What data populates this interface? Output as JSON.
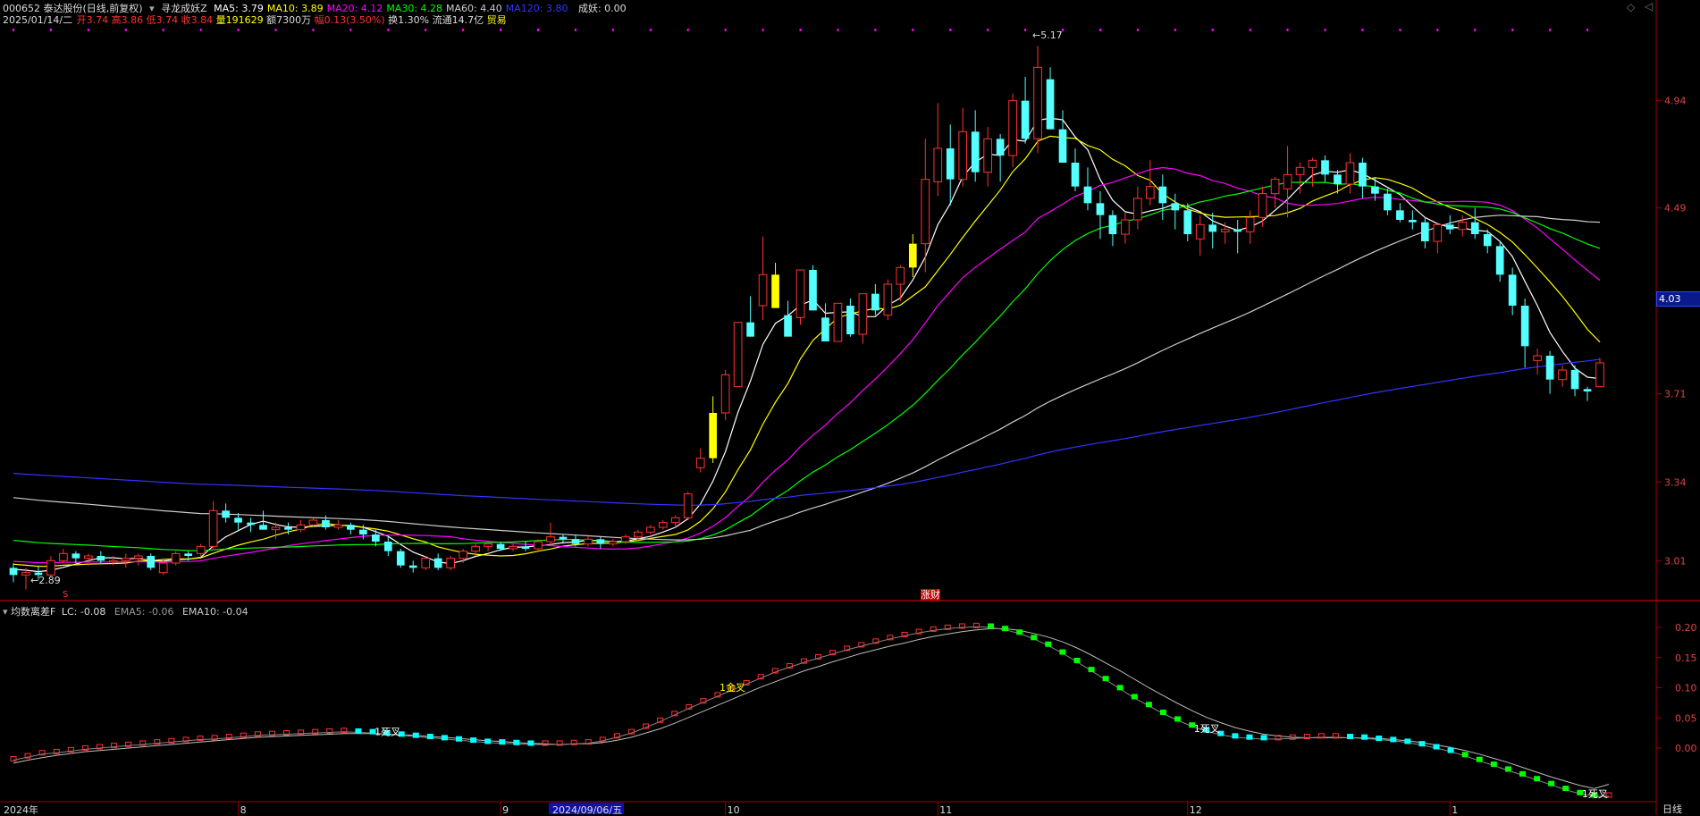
{
  "header": {
    "stock": "000652 泰达股份(日线,前复权)",
    "indicator_name": "寻龙成妖Z",
    "ma": [
      {
        "label": "MA5: 3.79",
        "color": "#ffffff"
      },
      {
        "label": "MA10: 3.89",
        "color": "#ffff00"
      },
      {
        "label": "MA20: 4.12",
        "color": "#ff00ff"
      },
      {
        "label": "MA30: 4.28",
        "color": "#00ff00"
      },
      {
        "label": "MA60: 4.40",
        "color": "#cccccc"
      },
      {
        "label": "MA120: 3.80",
        "color": "#3333ff"
      }
    ],
    "chengyao": "成妖: 0.00",
    "date": "2025/01/14/二",
    "open": "开3.74",
    "high": "高3.86",
    "low": "低3.74",
    "close": "收3.84",
    "volume": "量191629",
    "amount": "额7300万",
    "change": "幅0.13(3.50%)",
    "turnover": "换1.30%",
    "float": "流通14.7亿",
    "trade": "贸易"
  },
  "main_y_ticks": [
    {
      "v": 4.94,
      "label": "4.94"
    },
    {
      "v": 4.49,
      "label": "4.49"
    },
    {
      "v": 3.71,
      "label": "3.71"
    },
    {
      "v": 3.34,
      "label": "3.34"
    },
    {
      "v": 3.01,
      "label": "3.01"
    }
  ],
  "current_price": "4.03",
  "annotations": {
    "high_label": "5.17",
    "low_label": "2.89",
    "marker_s": "S",
    "zhangcai": "涨财"
  },
  "sub": {
    "title": "均数离差F",
    "lc": "LC: -0.08",
    "ema5": "EMA5: -0.06",
    "ema10": "EMA10: -0.04",
    "y_ticks": [
      {
        "v": 0.2,
        "label": "0.20"
      },
      {
        "v": 0.15,
        "label": "0.15"
      },
      {
        "v": 0.1,
        "label": "0.10"
      },
      {
        "v": 0.05,
        "label": "0.05"
      },
      {
        "v": 0.0,
        "label": "0.00"
      }
    ],
    "cross_labels": [
      {
        "text": "1死叉",
        "bar": 26,
        "color": "#ffffff"
      },
      {
        "text": "1金叉",
        "bar": 50,
        "color": "#ffff00"
      },
      {
        "text": "1死叉",
        "bar": 83,
        "color": "#ffffff"
      },
      {
        "text": "1死叉",
        "bar": 110,
        "color": "#ffffff"
      }
    ]
  },
  "x_axis": [
    {
      "label": "2024年",
      "bar": 0
    },
    {
      "label": "8",
      "bar": 18
    },
    {
      "label": "9",
      "bar": 39
    },
    {
      "label": "2024/09/06/五",
      "bar": 43,
      "highlight": true
    },
    {
      "label": "10",
      "bar": 57
    },
    {
      "label": "11",
      "bar": 74
    },
    {
      "label": "12",
      "bar": 94
    },
    {
      "label": "1",
      "bar": 115
    }
  ],
  "period_label": "日线",
  "colors": {
    "up": "#ff3232",
    "down": "#54ffff",
    "limit": "#ffff00",
    "grid": "#a00000"
  },
  "chart_data": {
    "type": "candlestick",
    "ohlc": [
      [
        2.98,
        3.0,
        2.92,
        2.95
      ],
      [
        2.95,
        2.98,
        2.89,
        2.96
      ],
      [
        2.96,
        2.99,
        2.93,
        2.95
      ],
      [
        2.95,
        3.03,
        2.94,
        3.01
      ],
      [
        3.01,
        3.06,
        3.0,
        3.04
      ],
      [
        3.04,
        3.05,
        3.0,
        3.02
      ],
      [
        3.02,
        3.04,
        2.99,
        3.03
      ],
      [
        3.03,
        3.05,
        3.0,
        3.01
      ],
      [
        3.01,
        3.03,
        2.99,
        3.01
      ],
      [
        3.01,
        3.04,
        2.98,
        3.02
      ],
      [
        3.02,
        3.04,
        2.99,
        3.03
      ],
      [
        3.03,
        3.04,
        2.97,
        2.98
      ],
      [
        2.96,
        3.02,
        2.95,
        3.0
      ],
      [
        3.0,
        3.05,
        2.99,
        3.04
      ],
      [
        3.04,
        3.05,
        3.01,
        3.03
      ],
      [
        3.04,
        3.08,
        3.03,
        3.07
      ],
      [
        3.07,
        3.26,
        3.06,
        3.22
      ],
      [
        3.22,
        3.25,
        3.17,
        3.19
      ],
      [
        3.19,
        3.21,
        3.14,
        3.17
      ],
      [
        3.17,
        3.19,
        3.13,
        3.16
      ],
      [
        3.16,
        3.22,
        3.15,
        3.14
      ],
      [
        3.14,
        3.17,
        3.1,
        3.15
      ],
      [
        3.15,
        3.17,
        3.12,
        3.14
      ],
      [
        3.14,
        3.18,
        3.13,
        3.16
      ],
      [
        3.16,
        3.19,
        3.15,
        3.18
      ],
      [
        3.18,
        3.2,
        3.14,
        3.15
      ],
      [
        3.15,
        3.18,
        3.14,
        3.16
      ],
      [
        3.16,
        3.17,
        3.12,
        3.14
      ],
      [
        3.14,
        3.16,
        3.1,
        3.12
      ],
      [
        3.12,
        3.14,
        3.07,
        3.09
      ],
      [
        3.09,
        3.11,
        3.03,
        3.05
      ],
      [
        3.05,
        3.06,
        2.98,
        2.99
      ],
      [
        2.99,
        3.01,
        2.96,
        2.98
      ],
      [
        2.98,
        3.03,
        2.97,
        3.02
      ],
      [
        3.02,
        3.04,
        2.97,
        2.98
      ],
      [
        2.98,
        3.03,
        2.97,
        3.02
      ],
      [
        3.02,
        3.06,
        3.0,
        3.05
      ],
      [
        3.05,
        3.08,
        3.03,
        3.07
      ],
      [
        3.07,
        3.09,
        3.05,
        3.08
      ],
      [
        3.08,
        3.09,
        3.05,
        3.06
      ],
      [
        3.06,
        3.08,
        3.05,
        3.07
      ],
      [
        3.07,
        3.09,
        3.05,
        3.06
      ],
      [
        3.06,
        3.1,
        3.05,
        3.09
      ],
      [
        3.09,
        3.17,
        3.07,
        3.11
      ],
      [
        3.11,
        3.12,
        3.08,
        3.1
      ],
      [
        3.1,
        3.12,
        3.07,
        3.08
      ],
      [
        3.08,
        3.12,
        3.07,
        3.1
      ],
      [
        3.1,
        3.11,
        3.06,
        3.08
      ],
      [
        3.08,
        3.1,
        3.07,
        3.09
      ],
      [
        3.09,
        3.12,
        3.08,
        3.11
      ],
      [
        3.11,
        3.14,
        3.1,
        3.13
      ],
      [
        3.13,
        3.16,
        3.12,
        3.15
      ],
      [
        3.15,
        3.18,
        3.14,
        3.17
      ],
      [
        3.17,
        3.2,
        3.15,
        3.19
      ],
      [
        3.19,
        3.3,
        3.18,
        3.29
      ],
      [
        3.4,
        3.48,
        3.38,
        3.44
      ],
      [
        3.44,
        3.7,
        3.42,
        3.63
      ],
      [
        3.63,
        3.81,
        3.6,
        3.79
      ],
      [
        3.74,
        4.01,
        3.84,
        4.01
      ],
      [
        4.01,
        4.12,
        3.95,
        3.95
      ],
      [
        4.08,
        4.37,
        4.02,
        4.21
      ],
      [
        4.21,
        4.26,
        4.11,
        4.07
      ],
      [
        4.04,
        4.1,
        3.96,
        3.95
      ],
      [
        4.03,
        4.13,
        4.0,
        4.23
      ],
      [
        4.23,
        4.25,
        4.06,
        4.06
      ],
      [
        4.03,
        4.09,
        3.95,
        3.93
      ],
      [
        3.93,
        4.09,
        3.93,
        4.09
      ],
      [
        4.08,
        4.11,
        3.95,
        3.96
      ],
      [
        3.96,
        4.12,
        3.92,
        4.13
      ],
      [
        4.13,
        4.17,
        4.04,
        4.06
      ],
      [
        4.04,
        4.19,
        4.02,
        4.17
      ],
      [
        4.17,
        4.25,
        4.1,
        4.24
      ],
      [
        4.24,
        4.38,
        4.2,
        4.34
      ],
      [
        4.34,
        4.78,
        4.22,
        4.61
      ],
      [
        4.6,
        4.93,
        4.54,
        4.74
      ],
      [
        4.74,
        4.84,
        4.5,
        4.61
      ],
      [
        4.61,
        4.91,
        4.58,
        4.81
      ],
      [
        4.81,
        4.9,
        4.6,
        4.64
      ],
      [
        4.64,
        4.83,
        4.58,
        4.78
      ],
      [
        4.78,
        4.8,
        4.6,
        4.71
      ],
      [
        4.71,
        4.97,
        4.66,
        4.94
      ],
      [
        4.94,
        5.04,
        4.76,
        4.78
      ],
      [
        4.78,
        5.17,
        4.72,
        5.08
      ],
      [
        5.03,
        5.08,
        4.82,
        4.82
      ],
      [
        4.82,
        4.9,
        4.7,
        4.68
      ],
      [
        4.68,
        4.74,
        4.56,
        4.58
      ],
      [
        4.58,
        4.66,
        4.48,
        4.51
      ],
      [
        4.51,
        4.56,
        4.36,
        4.46
      ],
      [
        4.46,
        4.48,
        4.33,
        4.38
      ],
      [
        4.38,
        4.47,
        4.34,
        4.44
      ],
      [
        4.44,
        4.58,
        4.4,
        4.53
      ],
      [
        4.53,
        4.69,
        4.5,
        4.58
      ],
      [
        4.58,
        4.63,
        4.44,
        4.51
      ],
      [
        4.51,
        4.55,
        4.4,
        4.48
      ],
      [
        4.48,
        4.51,
        4.35,
        4.38
      ],
      [
        4.36,
        4.46,
        4.29,
        4.42
      ],
      [
        4.42,
        4.47,
        4.32,
        4.39
      ],
      [
        4.39,
        4.43,
        4.34,
        4.4
      ],
      [
        4.4,
        4.44,
        4.3,
        4.39
      ],
      [
        4.39,
        4.48,
        4.34,
        4.45
      ],
      [
        4.45,
        4.58,
        4.41,
        4.55
      ],
      [
        4.55,
        4.62,
        4.49,
        4.61
      ],
      [
        4.57,
        4.75,
        4.45,
        4.63
      ],
      [
        4.63,
        4.68,
        4.55,
        4.66
      ],
      [
        4.66,
        4.7,
        4.58,
        4.69
      ],
      [
        4.69,
        4.71,
        4.6,
        4.63
      ],
      [
        4.63,
        4.65,
        4.55,
        4.59
      ],
      [
        4.59,
        4.72,
        4.55,
        4.68
      ],
      [
        4.68,
        4.7,
        4.53,
        4.58
      ],
      [
        4.58,
        4.62,
        4.52,
        4.55
      ],
      [
        4.55,
        4.57,
        4.46,
        4.48
      ],
      [
        4.48,
        4.51,
        4.43,
        4.44
      ],
      [
        4.44,
        4.48,
        4.4,
        4.43
      ],
      [
        4.43,
        4.45,
        4.32,
        4.35
      ],
      [
        4.35,
        4.43,
        4.3,
        4.42
      ],
      [
        4.42,
        4.46,
        4.38,
        4.4
      ],
      [
        4.4,
        4.46,
        4.37,
        4.43
      ],
      [
        4.43,
        4.49,
        4.36,
        4.38
      ],
      [
        4.38,
        4.4,
        4.3,
        4.33
      ],
      [
        4.33,
        4.35,
        4.18,
        4.21
      ],
      [
        4.21,
        4.24,
        4.04,
        4.08
      ],
      [
        4.08,
        4.11,
        3.82,
        3.91
      ],
      [
        3.85,
        3.9,
        3.79,
        3.87
      ],
      [
        3.87,
        3.89,
        3.71,
        3.77
      ],
      [
        3.77,
        3.83,
        3.74,
        3.81
      ],
      [
        3.81,
        3.83,
        3.7,
        3.73
      ],
      [
        3.73,
        3.74,
        3.68,
        3.72
      ],
      [
        3.74,
        3.86,
        3.74,
        3.84
      ]
    ],
    "limit_up_bars": [
      56,
      61,
      72
    ],
    "ma_series": [
      {
        "name": "MA5",
        "color": "#ffffff",
        "first": [
          2.98,
          3.0
        ]
      },
      {
        "name": "MA10",
        "color": "#ffff00",
        "first": [
          3.0,
          3.0
        ]
      },
      {
        "name": "MA20",
        "color": "#ff00ff",
        "first": [
          3.01,
          3.02
        ]
      },
      {
        "name": "MA30",
        "color": "#00ff00",
        "first": [
          3.1,
          3.08
        ]
      },
      {
        "name": "MA60",
        "color": "#cccccc",
        "first": [
          3.28,
          3.24
        ]
      },
      {
        "name": "MA120",
        "color": "#3333ff",
        "first": [
          3.38,
          3.36
        ]
      }
    ],
    "ylim": [
      2.85,
      5.25
    ],
    "sub_chart": {
      "lc": [
        -0.02,
        -0.015,
        -0.01,
        -0.008,
        -0.005,
        -0.002,
        0.0,
        0.002,
        0.004,
        0.006,
        0.008,
        0.01,
        0.012,
        0.014,
        0.015,
        0.017,
        0.019,
        0.021,
        0.022,
        0.023,
        0.024,
        0.025,
        0.026,
        0.027,
        0.026,
        0.025,
        0.023,
        0.021,
        0.019,
        0.017,
        0.015,
        0.013,
        0.011,
        0.009,
        0.008,
        0.007,
        0.006,
        0.006,
        0.006,
        0.007,
        0.008,
        0.012,
        0.018,
        0.025,
        0.034,
        0.044,
        0.055,
        0.066,
        0.076,
        0.086,
        0.096,
        0.106,
        0.116,
        0.126,
        0.134,
        0.142,
        0.149,
        0.156,
        0.163,
        0.169,
        0.175,
        0.181,
        0.186,
        0.191,
        0.195,
        0.198,
        0.2,
        0.201,
        0.2,
        0.196,
        0.19,
        0.181,
        0.17,
        0.157,
        0.143,
        0.128,
        0.113,
        0.098,
        0.083,
        0.07,
        0.057,
        0.046,
        0.036,
        0.028,
        0.022,
        0.018,
        0.016,
        0.015,
        0.015,
        0.016,
        0.017,
        0.018,
        0.018,
        0.017,
        0.016,
        0.014,
        0.012,
        0.009,
        0.005,
        0.0,
        -0.006,
        -0.013,
        -0.021,
        -0.029,
        -0.037,
        -0.045,
        -0.053,
        -0.061,
        -0.069,
        -0.076,
        -0.08,
        -0.08
      ],
      "ema5": [
        -0.025,
        -0.02,
        -0.016,
        -0.012,
        -0.009,
        -0.006,
        -0.004,
        -0.002,
        0.0,
        0.002,
        0.004,
        0.006,
        0.008,
        0.01,
        0.012,
        0.014,
        0.016,
        0.018,
        0.019,
        0.02,
        0.021,
        0.022,
        0.023,
        0.024,
        0.024,
        0.024,
        0.023,
        0.022,
        0.021,
        0.019,
        0.018,
        0.016,
        0.014,
        0.012,
        0.011,
        0.009,
        0.008,
        0.007,
        0.006,
        0.007,
        0.007,
        0.009,
        0.013,
        0.018,
        0.025,
        0.032,
        0.041,
        0.051,
        0.061,
        0.071,
        0.081,
        0.091,
        0.101,
        0.11,
        0.119,
        0.128,
        0.135,
        0.143,
        0.15,
        0.157,
        0.163,
        0.169,
        0.174,
        0.18,
        0.185,
        0.189,
        0.193,
        0.196,
        0.198,
        0.198,
        0.195,
        0.19,
        0.184,
        0.176,
        0.166,
        0.154,
        0.141,
        0.128,
        0.114,
        0.1,
        0.087,
        0.074,
        0.062,
        0.051,
        0.042,
        0.034,
        0.028,
        0.023,
        0.02,
        0.018,
        0.017,
        0.017,
        0.017,
        0.017,
        0.017,
        0.016,
        0.014,
        0.012,
        0.009,
        0.005,
        0.001,
        -0.004,
        -0.01,
        -0.017,
        -0.024,
        -0.032,
        -0.04,
        -0.048,
        -0.055,
        -0.062,
        -0.067,
        -0.06
      ]
    }
  }
}
